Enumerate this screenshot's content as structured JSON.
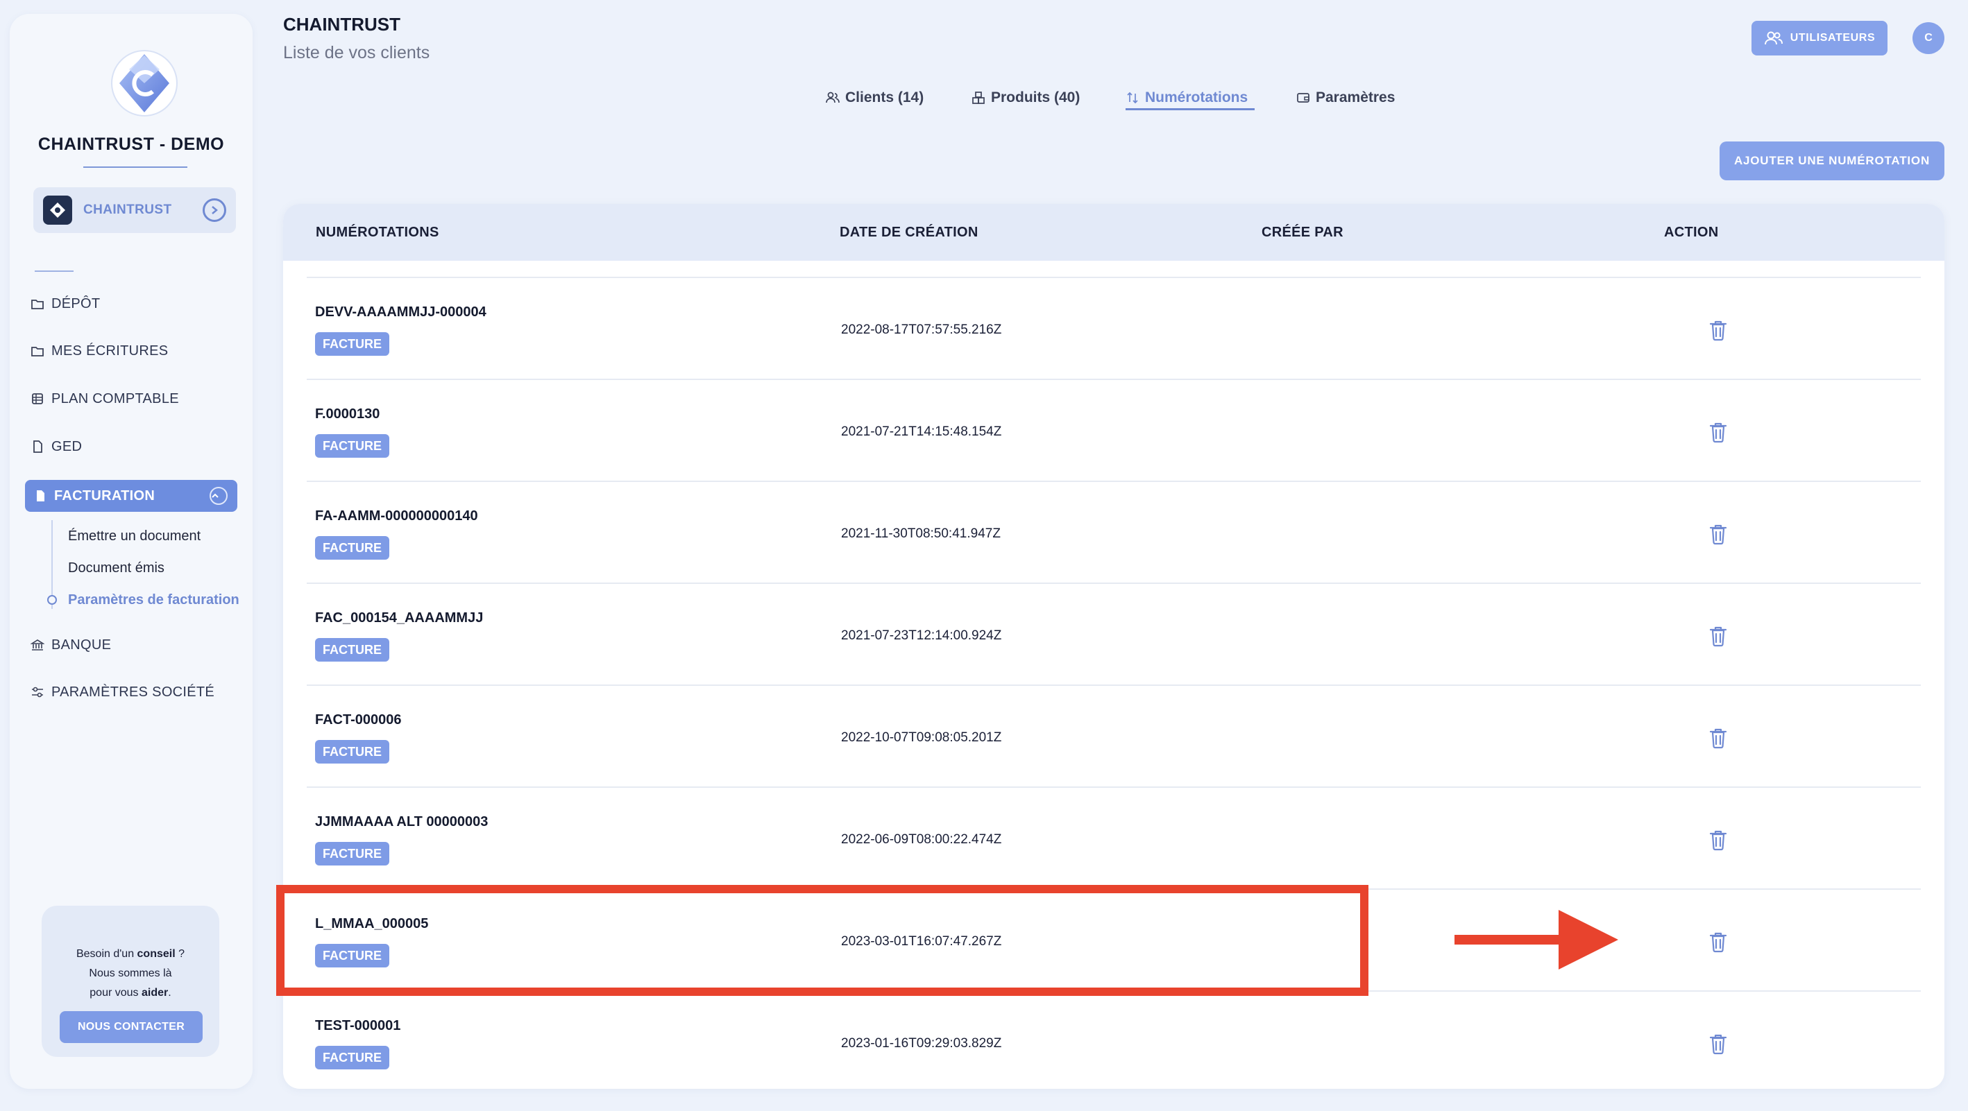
{
  "sidebar": {
    "company_name": "CHAINTRUST - DEMO",
    "org_label": "CHAINTRUST",
    "nav": {
      "depot": "DÉPÔT",
      "ecritures": "MES ÉCRITURES",
      "plan": "PLAN COMPTABLE",
      "ged": "GED",
      "facturation": "FACTURATION",
      "banque": "BANQUE",
      "parametres_societe": "PARAMÈTRES SOCIÉTÉ"
    },
    "sub": {
      "emettre": "Émettre un document",
      "emis": "Document émis",
      "parametres": "Paramètres de facturation"
    },
    "help": {
      "line1_pre": "Besoin d'un ",
      "line1_bold": "conseil",
      "line1_post": " ?",
      "line2": "Nous sommes là",
      "line3_pre": "pour vous ",
      "line3_bold": "aider",
      "line3_post": ".",
      "button": "NOUS CONTACTER"
    }
  },
  "header": {
    "title": "CHAINTRUST",
    "subtitle": "Liste de vos clients",
    "users_button": "UTILISATEURS",
    "avatar_initial": "C"
  },
  "tabs": {
    "clients": "Clients (14)",
    "produits": "Produits (40)",
    "numerotations": "Numérotations",
    "parametres": "Paramètres"
  },
  "add_button": "AJOUTER UNE NUMÉROTATION",
  "table": {
    "columns": [
      "NUMÉROTATIONS",
      "DATE DE CRÉATION",
      "CRÉÉE PAR",
      "ACTION"
    ],
    "rows": [
      {
        "name": "DEVV-AAAAMMJJ-000004",
        "type": "FACTURE",
        "date": "2022-08-17T07:57:55.216Z"
      },
      {
        "name": "F.0000130",
        "type": "FACTURE",
        "date": "2021-07-21T14:15:48.154Z"
      },
      {
        "name": "FA-AAMM-000000000140",
        "type": "FACTURE",
        "date": "2021-11-30T08:50:41.947Z"
      },
      {
        "name": "FAC_000154_AAAAMMJJ",
        "type": "FACTURE",
        "date": "2021-07-23T12:14:00.924Z"
      },
      {
        "name": "FACT-000006",
        "type": "FACTURE",
        "date": "2022-10-07T09:08:05.201Z"
      },
      {
        "name": "JJMMAAAA ALT 00000003",
        "type": "FACTURE",
        "date": "2022-06-09T08:00:22.474Z"
      },
      {
        "name": "L_MMAA_000005",
        "type": "FACTURE",
        "date": "2023-03-01T16:07:47.267Z"
      },
      {
        "name": "TEST-000001",
        "type": "FACTURE",
        "date": "2023-01-16T09:29:03.829Z"
      }
    ]
  },
  "colors": {
    "accent": "#6f89d2",
    "button": "#86a2ea",
    "annotation": "#e8432d"
  }
}
